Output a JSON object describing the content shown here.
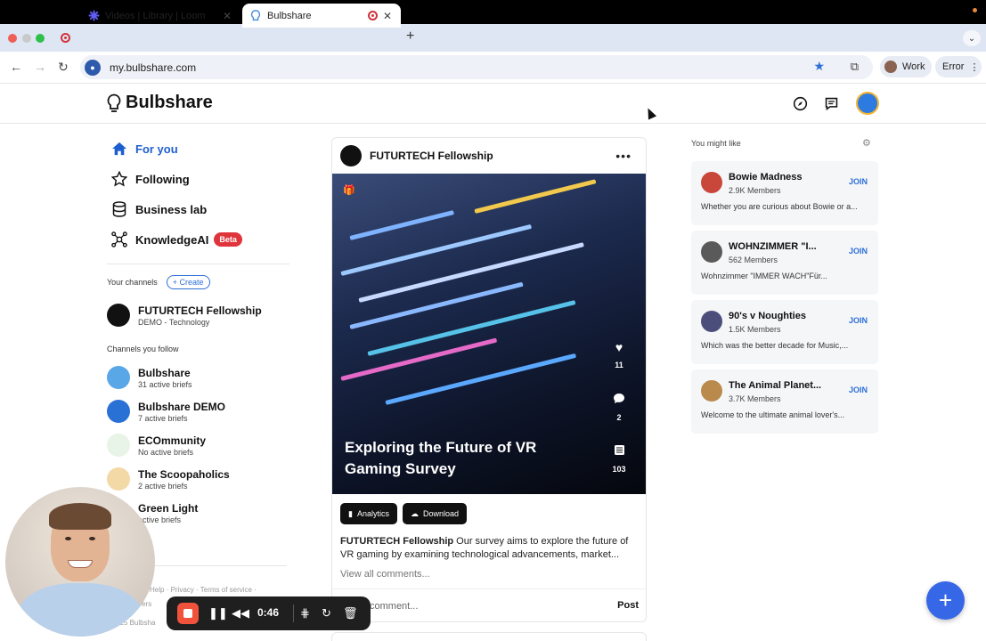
{
  "browser": {
    "tabs": [
      {
        "label": "Videos | Library | Loom"
      },
      {
        "label": "Bulbshare"
      }
    ],
    "url": "my.bulbshare.com",
    "profile_label": "Work",
    "error_label": "Error"
  },
  "header": {
    "brand": "Bulbshare"
  },
  "sidebar": {
    "nav": [
      {
        "label": "For you"
      },
      {
        "label": "Following"
      },
      {
        "label": "Business lab"
      },
      {
        "label": "KnowledgeAI",
        "badge": "Beta"
      }
    ],
    "your_channels_label": "Your channels",
    "create_label": "+ Create",
    "your_channels": [
      {
        "name": "FUTURTECH Fellowship",
        "sub": "DEMO - Technology"
      }
    ],
    "follow_label": "Channels you follow",
    "followed": [
      {
        "name": "Bulbshare",
        "sub": "31 active briefs"
      },
      {
        "name": "Bulbshare DEMO",
        "sub": "7 active briefs"
      },
      {
        "name": "ECOmmunity",
        "sub": "No active briefs"
      },
      {
        "name": "The Scoopaholics",
        "sub": "2 active briefs"
      },
      {
        "name": "Green Light",
        "sub": "active briefs"
      }
    ],
    "footer_links": "Help · Privacy · Terms of service ·",
    "careers": "reers",
    "copyright": "025 Bulbsha"
  },
  "post": {
    "channel": "FUTURTECH Fellowship",
    "title": "Exploring the Future of VR Gaming Survey",
    "likes": "11",
    "comments": "2",
    "responses": "103",
    "analytics_label": "Analytics",
    "download_label": "Download",
    "desc_author": "FUTURTECH Fellowship",
    "desc_text": " Our survey aims to explore the future of VR gaming by examining technological advancements, market...",
    "view_all": "View all comments...",
    "comment_placeholder": "comment...",
    "post_label": "Post"
  },
  "suggestions": {
    "title": "You might like",
    "join_label": "JOIN",
    "items": [
      {
        "name": "Bowie Madness",
        "members": "2.9K Members",
        "desc": "Whether you are curious about Bowie or a...",
        "color": "#c8463a"
      },
      {
        "name": "WOHNZIMMER \"I...",
        "members": "562 Members",
        "desc": "Wohnzimmer \"IMMER WACH\"Für...",
        "color": "#5a5a5a"
      },
      {
        "name": "90's v Noughties",
        "members": "1.5K Members",
        "desc": "Which was the better decade for Music,...",
        "color": "#4b4e7a"
      },
      {
        "name": "The Animal Planet...",
        "members": "3.7K Members",
        "desc": "Welcome to the ultimate animal lover's...",
        "color": "#b98a4b"
      }
    ]
  },
  "recorder": {
    "time": "0:46"
  },
  "colors": {
    "accent": "#1e5fcf",
    "fab": "#3567e6",
    "beta": "#e0343c"
  }
}
